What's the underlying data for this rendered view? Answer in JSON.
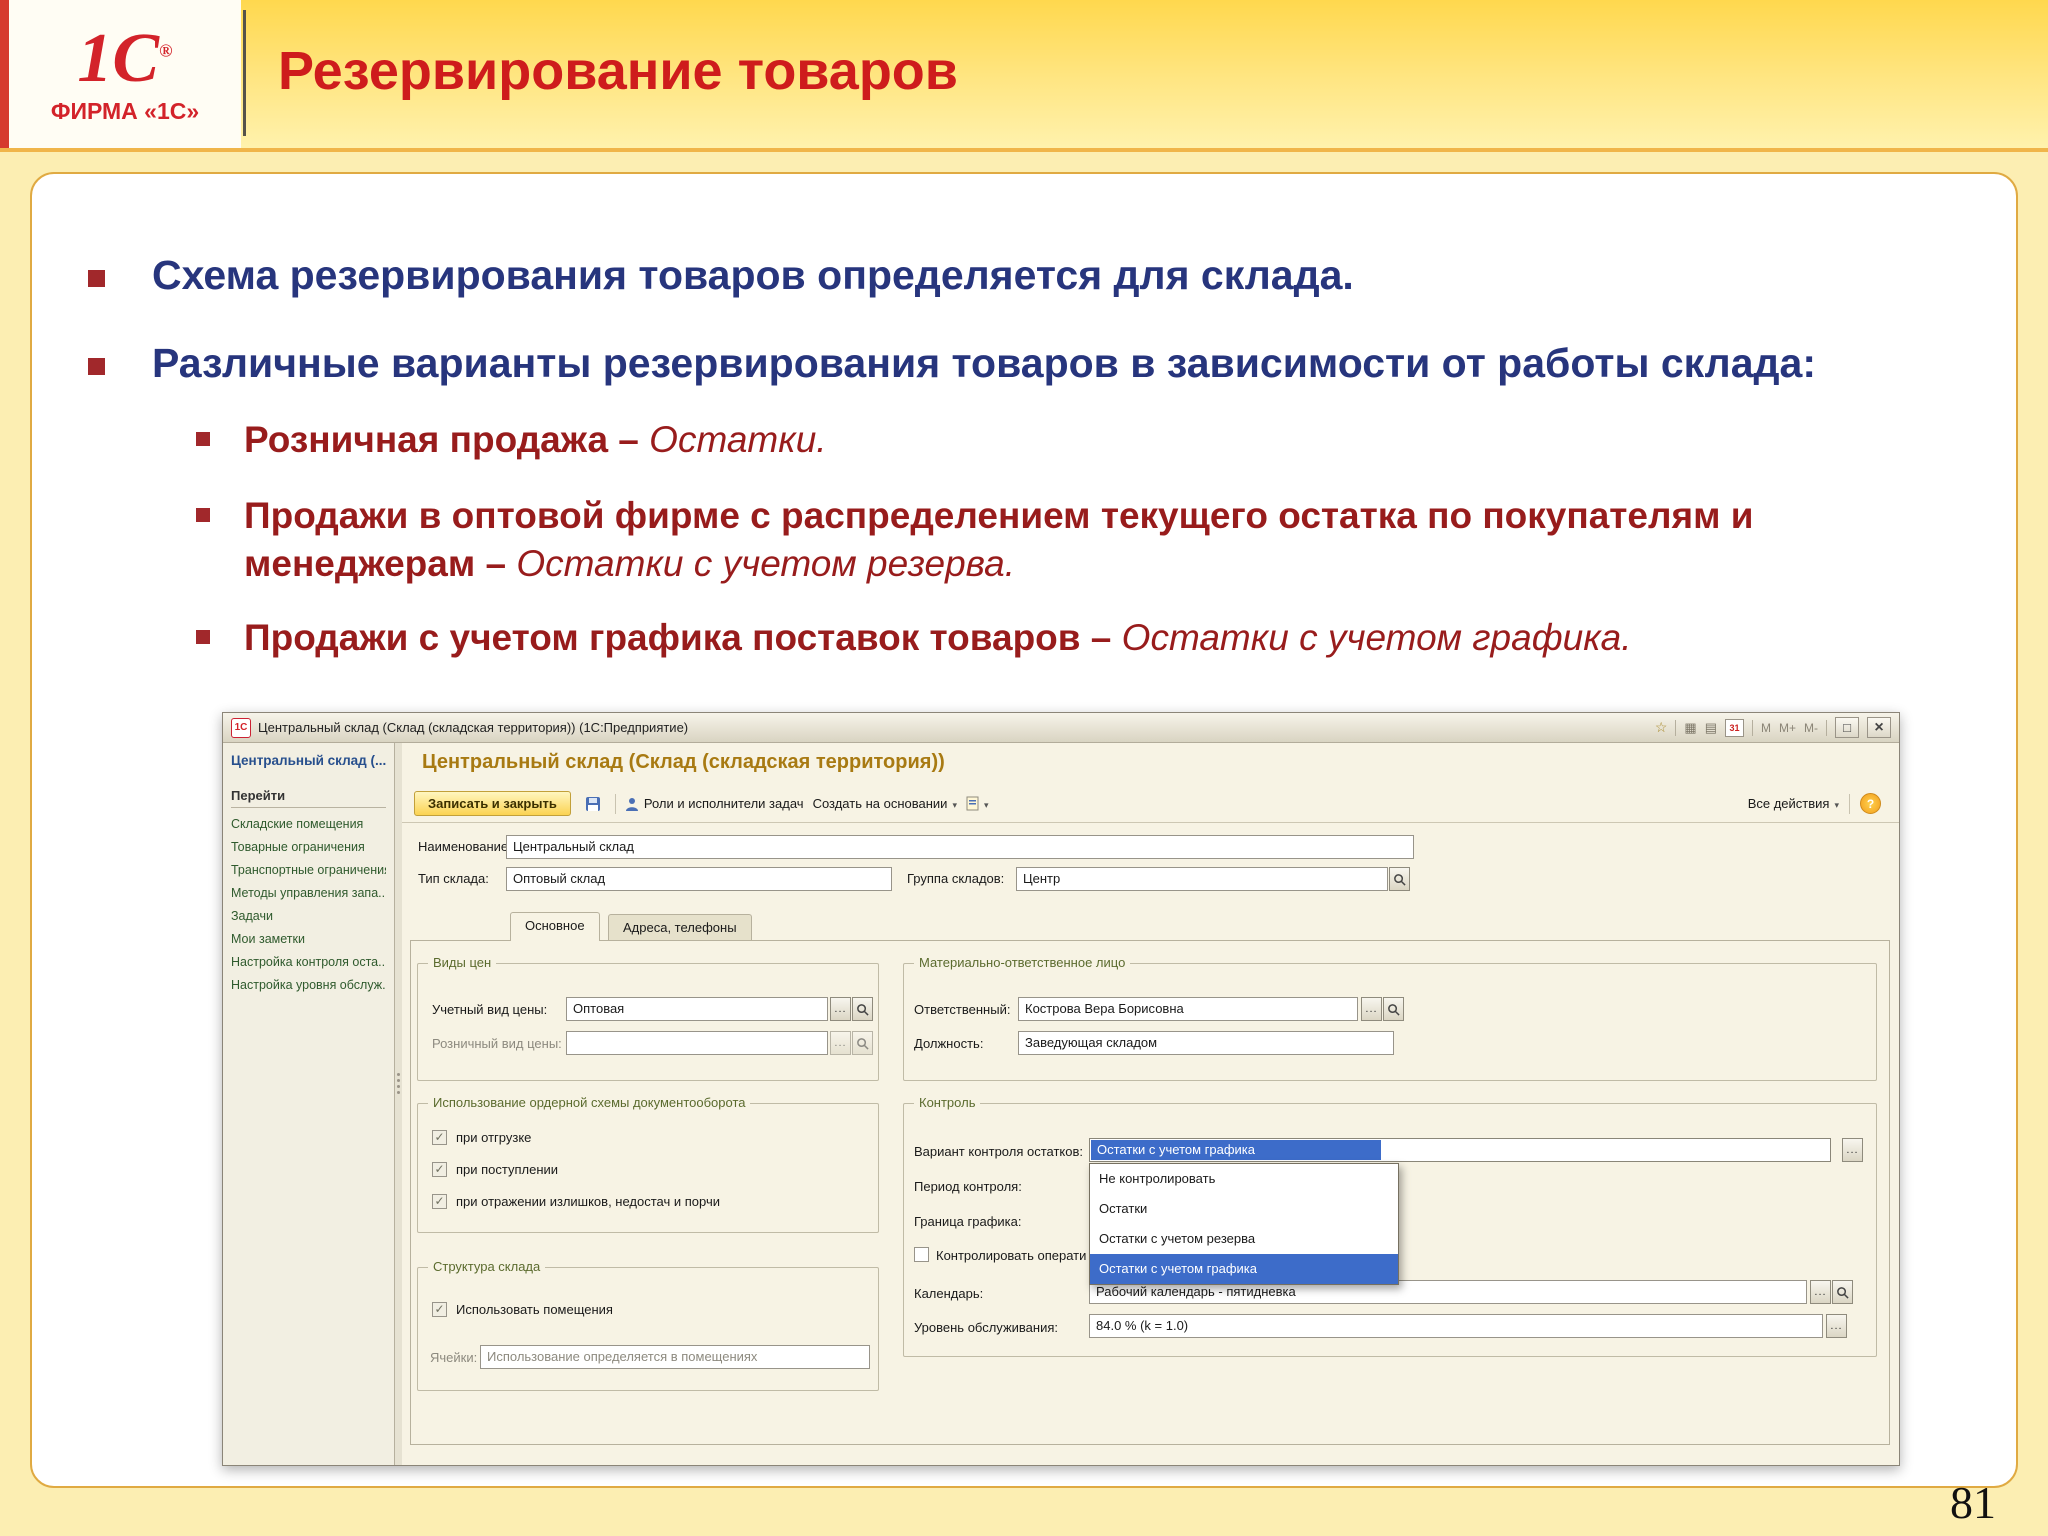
{
  "colors": {
    "accent_red": "#ce1c1c",
    "heading_blue": "#27357d",
    "sub_maroon": "#981c1c",
    "selection_blue": "#3d6cc9",
    "header_gold": "#ffd84e"
  },
  "slide": {
    "logo": {
      "brand": "1С",
      "reg": "®",
      "caption": "ФИРМА «1С»"
    },
    "title": "Резервирование товаров",
    "page_number": "81",
    "bullets": {
      "b1": "Схема резервирования товаров определяется для склада.",
      "b2": "Различные варианты резервирования товаров в зависимости от работы склада:",
      "sub1": {
        "text": "Розничная продажа – ",
        "em": "Остатки."
      },
      "sub2": {
        "text": "Продажи в оптовой фирме с распределением текущего остатка по покупателям и менеджерам – ",
        "em": "Остатки с учетом резерва."
      },
      "sub3": {
        "text": "Продажи с учетом графика поставок товаров – ",
        "em": "Остатки с учетом графика."
      }
    }
  },
  "window": {
    "titlebar": {
      "app": "1С",
      "title": "Центральный склад (Склад (складская территория))  (1С:Предприятие)",
      "calendar": "31",
      "mem": [
        "M",
        "M+",
        "M-"
      ]
    },
    "nav": {
      "header": "Центральный склад (...",
      "goto": "Перейти",
      "links": [
        "Складские помещения",
        "Товарные ограничения",
        "Транспортные ограничения",
        "Методы управления запа...",
        "Задачи",
        "Мои заметки",
        "Настройка контроля оста...",
        "Настройка уровня обслуж..."
      ]
    },
    "main": {
      "heading": "Центральный склад (Склад (складская территория))",
      "toolbar": {
        "save_close": "Записать и закрыть",
        "roles": "Роли и исполнители задач",
        "create": "Создать на основании",
        "all_actions": "Все действия",
        "help": "?"
      },
      "fields": {
        "name_label": "Наименование:",
        "name_value": "Центральный склад",
        "type_label": "Тип склада:",
        "type_value": "Оптовый склад",
        "group_label": "Группа складов:",
        "group_value": "Центр"
      },
      "tabs": [
        "Основное",
        "Адреса, телефоны"
      ],
      "prices": {
        "title": "Виды цен",
        "row1_label": "Учетный вид цены:",
        "row1_value": "Оптовая",
        "row2_label": "Розничный вид цены:",
        "row2_value": ""
      },
      "order": {
        "title": "Использование ордерной схемы документооборота",
        "checks": [
          "при отгрузке",
          "при поступлении",
          "при отражении излишков, недостач и порчи"
        ]
      },
      "structure": {
        "title": "Структура склада",
        "check": "Использовать помещения",
        "cells_label": "Ячейки:",
        "cells_value": "Использование определяется в помещениях"
      },
      "responsible": {
        "title": "Материально-ответственное лицо",
        "row1_label": "Ответственный:",
        "row1_value": "Кострова Вера Борисовна",
        "row2_label": "Должность:",
        "row2_value": "Заведующая складом"
      },
      "control": {
        "title": "Контроль",
        "variant_label": "Вариант контроля остатков:",
        "variant_value": "Остатки с учетом графика",
        "period_label": "Период контроля:",
        "border_label": "Граница графика:",
        "check_label": "Контролировать операти",
        "calendar_label": "Календарь:",
        "calendar_value": "Рабочий календарь - пятидневка",
        "service_label": "Уровень обслуживания:",
        "service_value": "84.0 % (k = 1.0)",
        "items": [
          "Не контролировать",
          "Остатки",
          "Остатки с учетом резерва",
          "Остатки с учетом графика"
        ]
      }
    }
  }
}
